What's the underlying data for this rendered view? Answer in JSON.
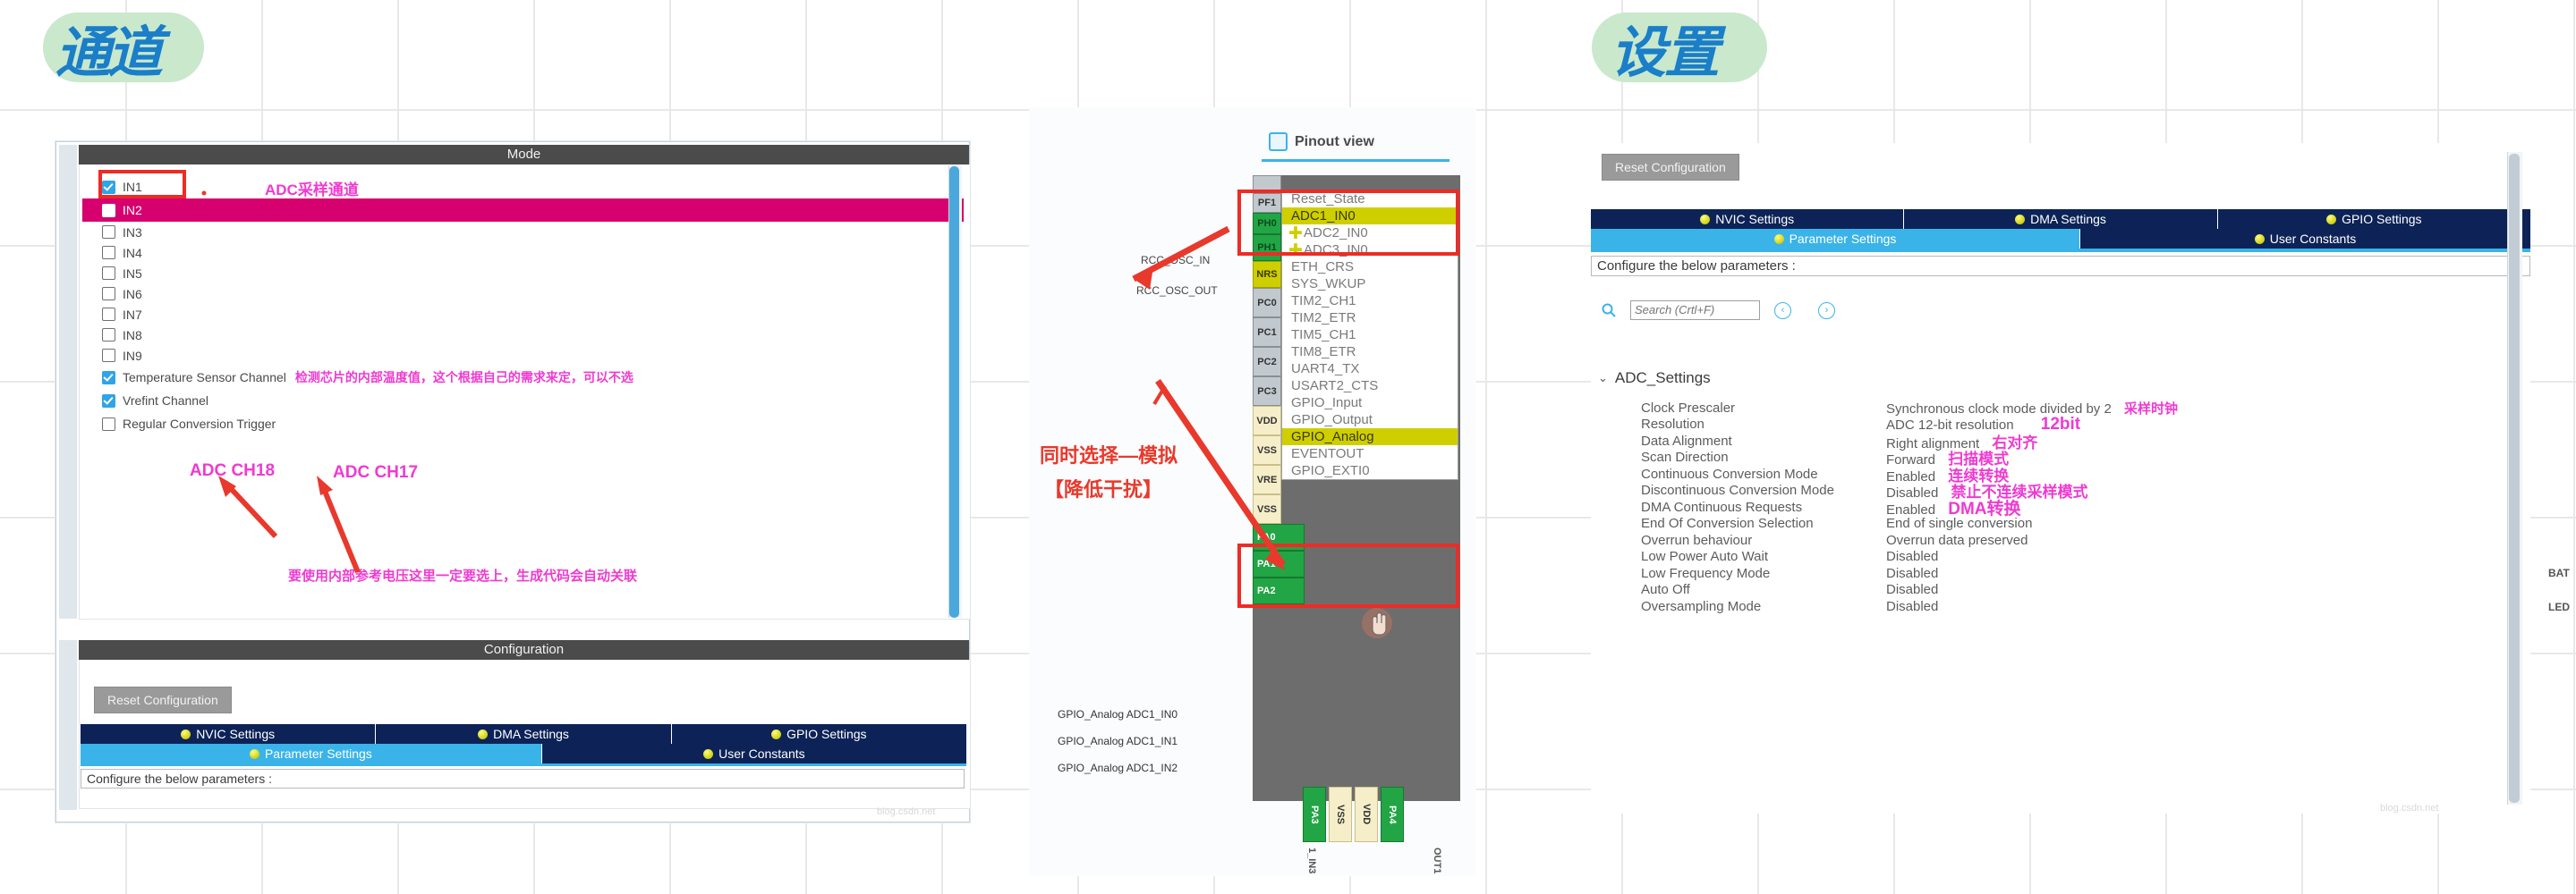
{
  "handwriting": {
    "left_note": "通道",
    "right_note": "设置"
  },
  "left_panel": {
    "mode_header": "Mode",
    "channels": [
      {
        "label": "IN1",
        "checked": true,
        "highlighted": false
      },
      {
        "label": "IN2",
        "checked": false,
        "highlighted": true
      },
      {
        "label": "IN3",
        "checked": false,
        "highlighted": false
      },
      {
        "label": "IN4",
        "checked": false,
        "highlighted": false
      },
      {
        "label": "IN5",
        "checked": false,
        "highlighted": false
      },
      {
        "label": "IN6",
        "checked": false,
        "highlighted": false
      },
      {
        "label": "IN7",
        "checked": false,
        "highlighted": false
      },
      {
        "label": "IN8",
        "checked": false,
        "highlighted": false
      },
      {
        "label": "IN9",
        "checked": false,
        "highlighted": false
      },
      {
        "label": "Temperature Sensor Channel",
        "checked": true,
        "highlighted": false
      },
      {
        "label": "Vrefint Channel",
        "checked": true,
        "highlighted": false
      },
      {
        "label": "Regular Conversion Trigger",
        "checked": false,
        "highlighted": false
      }
    ],
    "annotations": {
      "adc_sampling_channel": "ADC采样通道",
      "adc_ch18": "ADC CH18",
      "adc_ch17": "ADC CH17",
      "temp_note": "检测芯片的内部温度值，这个根据自己的需求来定，可以不选",
      "vref_note": "要使用内部参考电压这里一定要选上，生成代码会自动关联"
    },
    "configuration_header": "Configuration",
    "reset_button": "Reset Configuration",
    "tabs_row1": [
      "NVIC Settings",
      "DMA Settings",
      "GPIO Settings"
    ],
    "tabs_row2": [
      "Parameter Settings",
      "User Constants"
    ],
    "active_tab": "Parameter Settings",
    "configure_note": "Configure the below parameters :",
    "watermark": "blog.csdn.net"
  },
  "pinout_panel": {
    "title": "Pinout view",
    "left_signals": [
      "RCC_OSC_IN",
      "RCC_OSC_OUT"
    ],
    "menu_top": [
      {
        "label": "Reset_State",
        "selected": false,
        "plus": false
      },
      {
        "label": "ADC1_IN0",
        "selected": true,
        "plus": false
      },
      {
        "label": "ADC2_IN0",
        "selected": false,
        "plus": true
      },
      {
        "label": "ADC3_IN0",
        "selected": false,
        "plus": true
      },
      {
        "label": "ETH_CRS",
        "selected": false,
        "plus": false
      },
      {
        "label": "SYS_WKUP",
        "selected": false,
        "plus": false
      },
      {
        "label": "TIM2_CH1",
        "selected": false,
        "plus": false
      },
      {
        "label": "TIM2_ETR",
        "selected": false,
        "plus": false
      },
      {
        "label": "TIM5_CH1",
        "selected": false,
        "plus": false
      },
      {
        "label": "TIM8_ETR",
        "selected": false,
        "plus": false
      },
      {
        "label": "UART4_TX",
        "selected": false,
        "plus": false
      },
      {
        "label": "USART2_CTS",
        "selected": false,
        "plus": false
      },
      {
        "label": "GPIO_Input",
        "selected": false,
        "plus": false
      },
      {
        "label": "GPIO_Output",
        "selected": false,
        "plus": false
      },
      {
        "label": "GPIO_Analog",
        "selected": true,
        "plus": false
      },
      {
        "label": "EVENTOUT",
        "selected": false,
        "plus": false
      },
      {
        "label": "GPIO_EXTI0",
        "selected": false,
        "plus": false
      }
    ],
    "pin_tags": [
      "PF1",
      "PH0",
      "PH1",
      "NRS",
      "PC0",
      "PC1",
      "PC2",
      "PC3",
      "VDD",
      "VSS",
      "VRE",
      "VSS"
    ],
    "pin_rows": [
      {
        "label": "GPIO_Analog ADC1_IN0",
        "pin": "PA0"
      },
      {
        "label": "GPIO_Analog ADC1_IN1",
        "pin": "PA1"
      },
      {
        "label": "GPIO_Analog ADC1_IN2",
        "pin": "PA2"
      }
    ],
    "bottom_pins": [
      "PA3",
      "VSS",
      "VDD",
      "PA4"
    ],
    "bottom_labels": [
      "1_IN3",
      "OUT1"
    ],
    "annotation_line1": "同时选择—模拟",
    "annotation_line2": "【降低干扰】"
  },
  "right_panel": {
    "reset_button": "Reset Configuration",
    "tabs_row1": [
      "NVIC Settings",
      "DMA Settings",
      "GPIO Settings"
    ],
    "tabs_row2": [
      "Parameter Settings",
      "User Constants"
    ],
    "active_tab": "Parameter Settings",
    "configure_note": "Configure the below parameters :",
    "search_placeholder": "Search (Crtl+F)",
    "search_value": "",
    "nav_prev": "‹",
    "nav_next": "›",
    "group_label": "ADC_Settings",
    "parameters": [
      {
        "name": "Clock Prescaler",
        "value": "Synchronous clock mode divided by 2",
        "cn": "采样时钟"
      },
      {
        "name": "Resolution",
        "value": "ADC 12-bit resolution",
        "cn": "12bit"
      },
      {
        "name": "Data Alignment",
        "value": "Right alignment",
        "cn": "右对齐"
      },
      {
        "name": "Scan Direction",
        "value": "Forward",
        "cn": "扫描模式"
      },
      {
        "name": "Continuous Conversion Mode",
        "value": "Enabled",
        "cn": "连续转换"
      },
      {
        "name": "Discontinuous Conversion Mode",
        "value": "Disabled",
        "cn": "禁止不连续采样模式"
      },
      {
        "name": "DMA Continuous Requests",
        "value": "Enabled",
        "cn": "DMA转换"
      },
      {
        "name": "End Of Conversion Selection",
        "value": "End of single conversion",
        "cn": ""
      },
      {
        "name": "Overrun behaviour",
        "value": "Overrun data preserved",
        "cn": ""
      },
      {
        "name": "Low Power Auto Wait",
        "value": "Disabled",
        "cn": ""
      },
      {
        "name": "Low Frequency Mode",
        "value": "Disabled",
        "cn": ""
      },
      {
        "name": "Auto Off",
        "value": "Disabled",
        "cn": ""
      },
      {
        "name": "Oversampling Mode",
        "value": "Disabled",
        "cn": ""
      }
    ],
    "far_right_labels": [
      "BAT",
      "LED"
    ],
    "watermark": "blog.csdn.net"
  },
  "colors": {
    "accent_blue": "#3ab3e8",
    "tab_navy": "#0d2357",
    "magenta_highlight": "#d6006e",
    "annotation_pink": "#ef3ad0",
    "annotation_red": "#e8392c",
    "selected_yellow": "#cfcf00",
    "pin_green": "#22a544"
  }
}
